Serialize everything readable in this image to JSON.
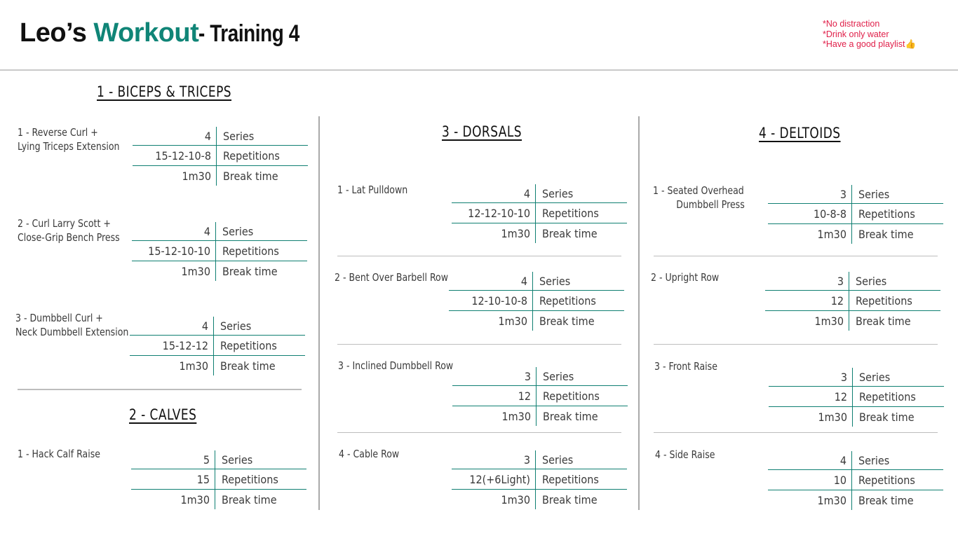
{
  "header": {
    "title_name": "Leo’s ",
    "title_accent": "Workout",
    "title_suffix": " - Training 4",
    "notes": [
      "*No distraction",
      "*Drink only water",
      "*Have a good playlist"
    ],
    "accent_color": "#108577",
    "notes_color": "#e0204a",
    "notes_icon": "thumbs-up-icon"
  },
  "row_labels": {
    "series": "Series",
    "repetitions": "Repetitions",
    "break": "Break time"
  },
  "biceps": {
    "title": "1 - BICEPS & TRICEPS",
    "exercises": [
      {
        "name": [
          "1 - Reverse Curl +",
          "Lying Triceps Extension"
        ],
        "series": "4",
        "reps": "15-12-10-8",
        "break": "1m30"
      },
      {
        "name": [
          "2 - Curl Larry Scott +",
          "Close-Grip Bench Press"
        ],
        "series": "4",
        "reps": "15-12-10-10",
        "break": "1m30"
      },
      {
        "name": [
          "3 - Dumbbell Curl +",
          "Neck Dumbbell Extension"
        ],
        "series": "4",
        "reps": "15-12-12",
        "break": "1m30"
      }
    ]
  },
  "calves": {
    "title": "2 - CALVES",
    "exercises": [
      {
        "name": [
          "1 - Hack Calf Raise"
        ],
        "series": "5",
        "reps": "15",
        "break": "1m30"
      }
    ]
  },
  "dorsals": {
    "title": "3 - DORSALS",
    "exercises": [
      {
        "name": [
          "1 - Lat Pulldown"
        ],
        "series": "4",
        "reps": "12-12-10-10",
        "break": "1m30"
      },
      {
        "name": [
          "2 - Bent Over Barbell Row"
        ],
        "series": "4",
        "reps": "12-10-10-8",
        "break": "1m30"
      },
      {
        "name": [
          "3 - Inclined Dumbbell Row"
        ],
        "series": "3",
        "reps": "12",
        "break": "1m30"
      },
      {
        "name": [
          "4 - Cable Row"
        ],
        "series": "3",
        "reps": "12(+6Light)",
        "break": "1m30"
      }
    ]
  },
  "deltoids": {
    "title": "4 - DELTOIDS",
    "exercises": [
      {
        "name": [
          "1 - Seated Overhead",
          "Dumbbell Press"
        ],
        "series": "3",
        "reps": "10-8-8",
        "break": "1m30"
      },
      {
        "name": [
          "2 - Upright Row"
        ],
        "series": "3",
        "reps": "12",
        "break": "1m30"
      },
      {
        "name": [
          "3 - Front Raise"
        ],
        "series": "3",
        "reps": "12",
        "break": "1m30"
      },
      {
        "name": [
          "4 - Side Raise"
        ],
        "series": "4",
        "reps": "10",
        "break": "1m30"
      }
    ]
  }
}
